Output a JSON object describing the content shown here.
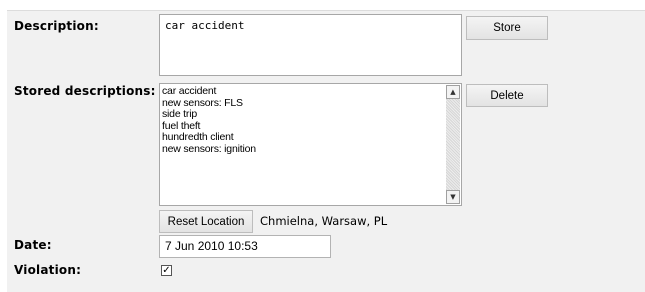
{
  "form": {
    "description": {
      "label": "Description:",
      "value": "car accident",
      "store_button": "Store"
    },
    "stored": {
      "label": "Stored descriptions:",
      "items": [
        "car accident",
        "new sensors: FLS",
        "side trip",
        "fuel theft",
        "hundredth client",
        "new sensors: ignition"
      ],
      "delete_button": "Delete"
    },
    "location": {
      "reset_button": "Reset Location",
      "text": "Chmielna, Warsaw, PL"
    },
    "date": {
      "label": "Date:",
      "value": "7 Jun 2010 10:53"
    },
    "violation": {
      "label": "Violation:",
      "checked": true,
      "check_glyph": "✓"
    }
  }
}
